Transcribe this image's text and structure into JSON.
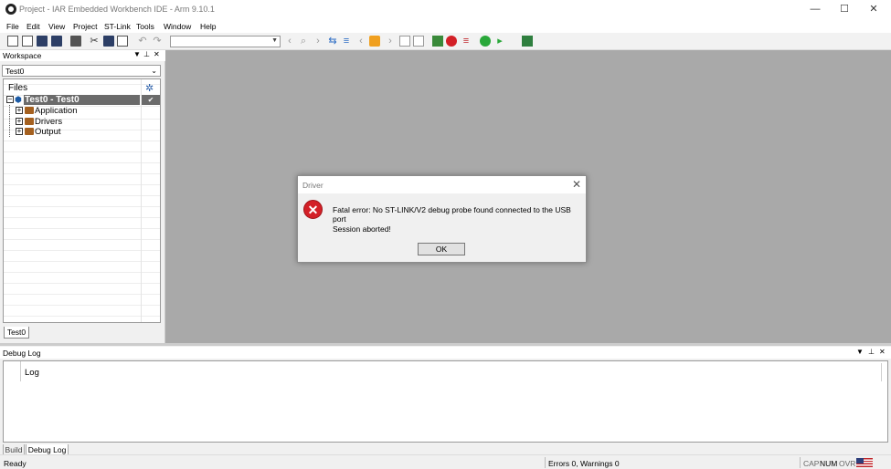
{
  "window": {
    "title": "Project - IAR Embedded Workbench IDE - Arm 9.10.1",
    "minimize": "—",
    "maximize": "☐",
    "close": "✕"
  },
  "menu": [
    "File",
    "Edit",
    "View",
    "Project",
    "ST-Link",
    "Tools",
    "Window",
    "Help"
  ],
  "toolbar": {
    "combo_value": ""
  },
  "workspace": {
    "title": "Workspace",
    "config": "Test0",
    "files_header": "Files",
    "root": "Test0 - Test0",
    "items": [
      "Application",
      "Drivers",
      "Output"
    ],
    "tab": "Test0",
    "checkmark": "✔",
    "gear": "✲"
  },
  "dialog": {
    "title": "Driver",
    "message": "Fatal error: No ST-LINK/V2 debug probe found connected to the USB port",
    "detail": "Session aborted!",
    "ok": "OK",
    "close": "✕",
    "icon": "✕"
  },
  "debug_log": {
    "title": "Debug Log",
    "column": "Log",
    "tabs": [
      "Build",
      "Debug Log"
    ]
  },
  "status": {
    "left": "Ready",
    "errors": "Errors 0, Warnings 0",
    "cap": "CAP",
    "num": "NUM",
    "ovr": "OVR"
  },
  "colors": {
    "error_red": "#d32027",
    "selection": "#6b6b6b",
    "workarea": "#a9a9a9"
  }
}
